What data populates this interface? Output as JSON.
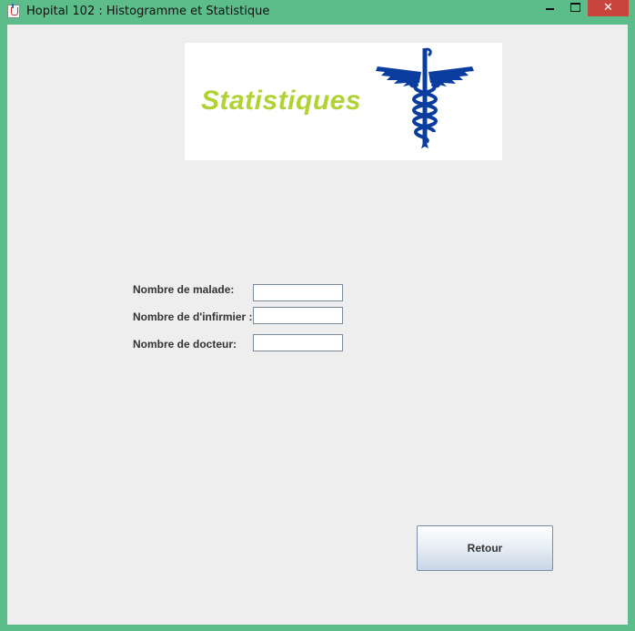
{
  "window": {
    "title": "Hopital 102 : Histogramme et Statistique",
    "icon": "java-cup-icon",
    "controls": {
      "minimize": "minimize-icon",
      "maximize": "maximize-icon",
      "close": "✕"
    }
  },
  "banner": {
    "title": "Statistiques",
    "title_color": "#b2d233",
    "emblem": "caduceus-icon",
    "emblem_color": "#0a3d9e"
  },
  "form": {
    "malade_label": "Nombre de malade:",
    "malade_value": "",
    "infirmier_label": "Nombre de d'infirmier :",
    "infirmier_value": "",
    "docteur_label": "Nombre de docteur:",
    "docteur_value": ""
  },
  "buttons": {
    "retour_label": "Retour"
  },
  "colors": {
    "window_border": "#5cbd8a",
    "close_button": "#c7453d",
    "client_background": "#eeeeee"
  }
}
